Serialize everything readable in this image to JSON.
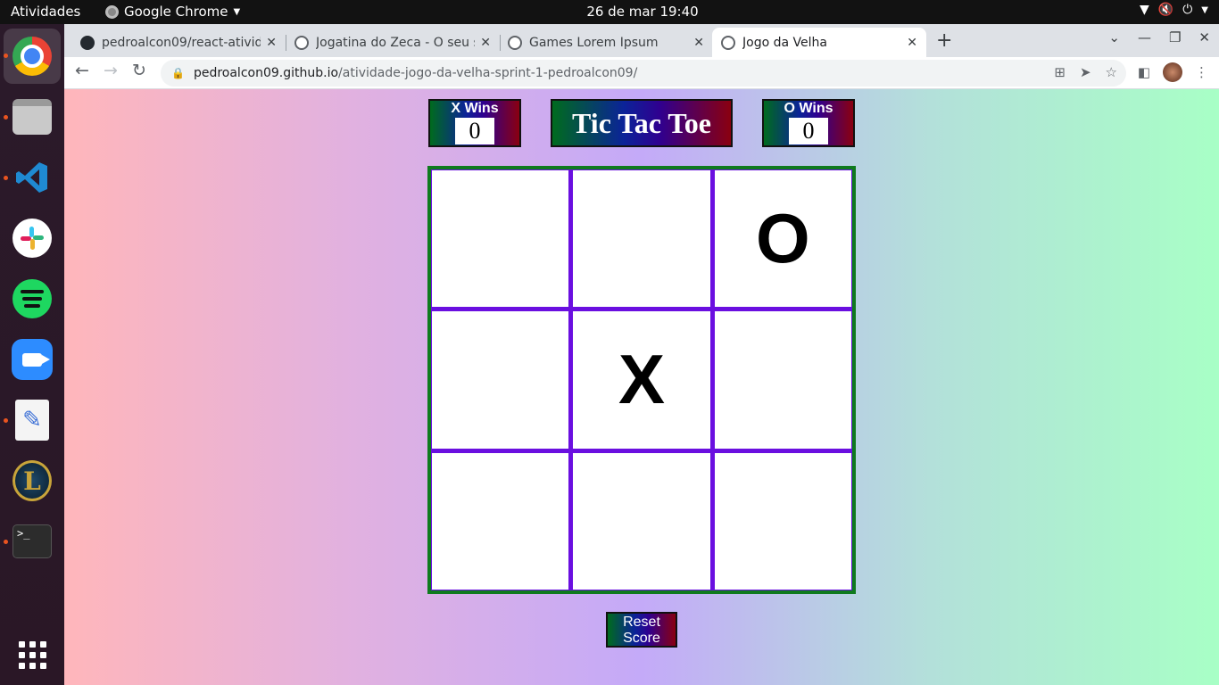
{
  "topbar": {
    "activities": "Atividades",
    "app_name": "Google Chrome",
    "clock": "26 de mar  19:40"
  },
  "dock": {
    "items": [
      "chrome-icon",
      "files-icon",
      "vscode-icon",
      "slack-icon",
      "spotify-icon",
      "zoom-icon",
      "text-editor-icon",
      "league-of-legends-icon",
      "terminal-icon",
      "app-grid-icon"
    ]
  },
  "browser": {
    "tabs": [
      {
        "title": "pedroalcon09/react-ativid",
        "favicon": "github-icon"
      },
      {
        "title": "Jogatina do Zeca - O seu s",
        "favicon": "globe-icon"
      },
      {
        "title": "Games Lorem Ipsum",
        "favicon": "globe-icon"
      },
      {
        "title": "Jogo da Velha",
        "favicon": "globe-icon"
      }
    ],
    "address": {
      "host": "pedroalcon09.github.io",
      "path": "/atividade-jogo-da-velha-sprint-1-pedroalcon09/"
    }
  },
  "game": {
    "x_wins_label": "X Wins",
    "x_wins": "0",
    "o_wins_label": "O Wins",
    "o_wins": "0",
    "title": "Tic Tac Toe",
    "board": [
      "",
      "",
      "O",
      "",
      "X",
      "",
      "",
      "",
      ""
    ],
    "reset_label": "Reset Score"
  },
  "colors": {
    "board_border": "#0f7a1e",
    "grid_lines": "#6a0fe0",
    "accent_dock_dot": "#e95420"
  }
}
